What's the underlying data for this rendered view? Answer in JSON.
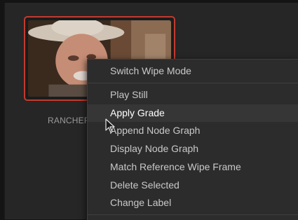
{
  "still": {
    "label": "RANCHER",
    "selected": true,
    "border_color": "#c33a2f"
  },
  "context_menu": {
    "items": [
      {
        "label": "Switch Wipe Mode",
        "hover": false
      },
      {
        "label": "Play Still",
        "hover": false
      },
      {
        "label": "Apply Grade",
        "hover": true
      },
      {
        "label": "Append Node Graph",
        "hover": false
      },
      {
        "label": "Display Node Graph",
        "hover": false
      },
      {
        "label": "Match Reference Wipe Frame",
        "hover": false
      },
      {
        "label": "Delete Selected",
        "hover": false
      },
      {
        "label": "Change Label",
        "hover": false
      }
    ]
  },
  "cursor": {
    "icon": "arrow-pointer-icon"
  }
}
